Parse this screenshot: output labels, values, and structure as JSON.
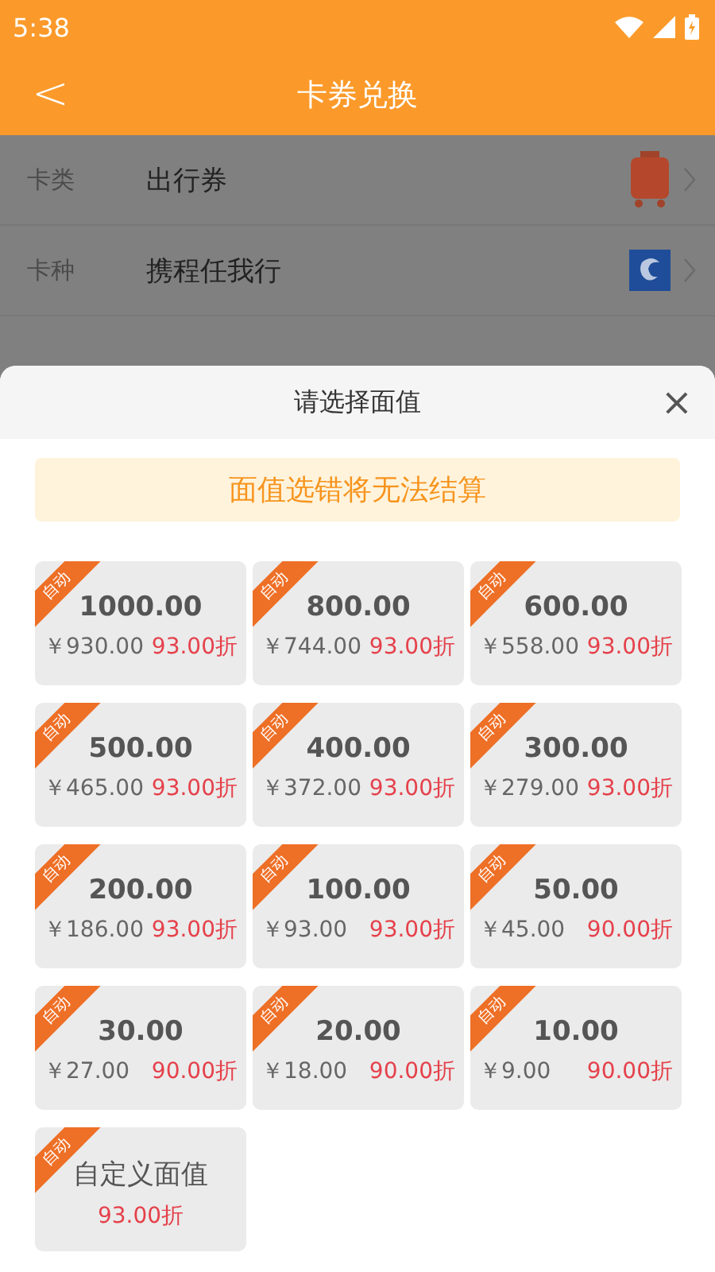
{
  "status_bar": {
    "time": "5:38"
  },
  "header": {
    "back": "<",
    "title": "卡券兑换"
  },
  "form_rows": [
    {
      "label": "卡类",
      "value": "出行券"
    },
    {
      "label": "卡种",
      "value": "携程任我行"
    }
  ],
  "sheet": {
    "title": "请选择面值",
    "close": "×",
    "notice": "面值选错将无法结算",
    "cards": [
      {
        "kind": "denomination",
        "tag": "自动",
        "value": "1000.00",
        "price": "￥930.00",
        "discount": "93.00折"
      },
      {
        "kind": "denomination",
        "tag": "自动",
        "value": "800.00",
        "price": "￥744.00",
        "discount": "93.00折"
      },
      {
        "kind": "denomination",
        "tag": "自动",
        "value": "600.00",
        "price": "￥558.00",
        "discount": "93.00折"
      },
      {
        "kind": "denomination",
        "tag": "自动",
        "value": "500.00",
        "price": "￥465.00",
        "discount": "93.00折"
      },
      {
        "kind": "denomination",
        "tag": "自动",
        "value": "400.00",
        "price": "￥372.00",
        "discount": "93.00折"
      },
      {
        "kind": "denomination",
        "tag": "自动",
        "value": "300.00",
        "price": "￥279.00",
        "discount": "93.00折"
      },
      {
        "kind": "denomination",
        "tag": "自动",
        "value": "200.00",
        "price": "￥186.00",
        "discount": "93.00折"
      },
      {
        "kind": "denomination",
        "tag": "自动",
        "value": "100.00",
        "price": "￥93.00",
        "discount": "93.00折"
      },
      {
        "kind": "denomination",
        "tag": "自动",
        "value": "50.00",
        "price": "￥45.00",
        "discount": "90.00折"
      },
      {
        "kind": "denomination",
        "tag": "自动",
        "value": "30.00",
        "price": "￥27.00",
        "discount": "90.00折"
      },
      {
        "kind": "denomination",
        "tag": "自动",
        "value": "20.00",
        "price": "￥18.00",
        "discount": "90.00折"
      },
      {
        "kind": "denomination",
        "tag": "自动",
        "value": "10.00",
        "price": "￥9.00",
        "discount": "90.00折"
      },
      {
        "kind": "custom",
        "tag": "自动",
        "value": "自定义面值",
        "discount": "93.00折"
      }
    ]
  }
}
